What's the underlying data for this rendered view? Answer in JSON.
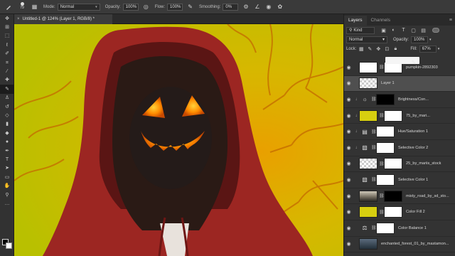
{
  "options_bar": {
    "brush_size": "79",
    "mode_label": "Mode:",
    "mode_value": "Normal",
    "opacity_label": "Opacity:",
    "opacity_value": "100%",
    "flow_label": "Flow:",
    "flow_value": "100%",
    "smoothing_label": "Smoothing:",
    "smoothing_value": "0%"
  },
  "document": {
    "tab_title": "Untitled-1 @ 124% (Layer 1, RGB/8) *",
    "canvas_bg": "#c9c400",
    "hood_color": "#9c2622"
  },
  "tools": [
    "move-tool",
    "artboard-tool",
    "marquee-tool",
    "lasso-tool",
    "quick-select-tool",
    "crop-tool",
    "eyedropper-tool",
    "healing-tool",
    "brush-tool",
    "clone-stamp-tool",
    "history-brush-tool",
    "eraser-tool",
    "gradient-tool",
    "blur-tool",
    "dodge-tool",
    "pen-tool",
    "type-tool",
    "path-select-tool",
    "rectangle-tool",
    "hand-tool",
    "zoom-tool",
    "edit-toolbar",
    "quick-mask",
    "screen-mode"
  ],
  "panel": {
    "tabs": [
      "Layers",
      "Channels"
    ],
    "filter_kind": "Kind",
    "blend_mode": "Normal",
    "opacity_label": "Opacity:",
    "opacity_value": "100%",
    "lock_label": "Lock:",
    "fill_label": "Fill:",
    "fill_value": "67%"
  },
  "layers": [
    {
      "name": "pumpkin-2892303",
      "thumb": "white",
      "mask": "white",
      "clip": false,
      "selected": false
    },
    {
      "name": "Layer 1",
      "thumb": "checker",
      "mask": "",
      "clip": false,
      "selected": true
    },
    {
      "name": "Brightness/Con...",
      "thumb": "adj",
      "icon": "☼",
      "mask": "black",
      "clip": true,
      "selected": false
    },
    {
      "name": "75_by_mari...",
      "thumb": "yellow",
      "mask": "white",
      "clip": true,
      "selected": false
    },
    {
      "name": "Hue/Saturation 1",
      "thumb": "adj",
      "icon": "▤",
      "mask": "white",
      "clip": true,
      "selected": false
    },
    {
      "name": "Selective Color 2",
      "thumb": "adj",
      "icon": "▧",
      "mask": "white",
      "clip": true,
      "selected": false
    },
    {
      "name": "25_by_mariis_stock",
      "thumb": "checker",
      "mask": "white",
      "clip": false,
      "selected": false
    },
    {
      "name": "Selective Color 1",
      "thumb": "adj",
      "icon": "▧",
      "mask": "white",
      "clip": false,
      "selected": false
    },
    {
      "name": "misty_road_by_sd_sto...",
      "thumb": "road",
      "mask": "black",
      "clip": false,
      "selected": false
    },
    {
      "name": "Color Fill 2",
      "thumb": "yellow",
      "mask": "white",
      "clip": false,
      "selected": false
    },
    {
      "name": "Color Balance 1",
      "thumb": "adj",
      "icon": "⚖",
      "mask": "white",
      "clip": false,
      "selected": false
    },
    {
      "name": "enchanted_forest_01_by_mastamon...",
      "thumb": "forest",
      "mask": "",
      "clip": false,
      "selected": false
    }
  ]
}
